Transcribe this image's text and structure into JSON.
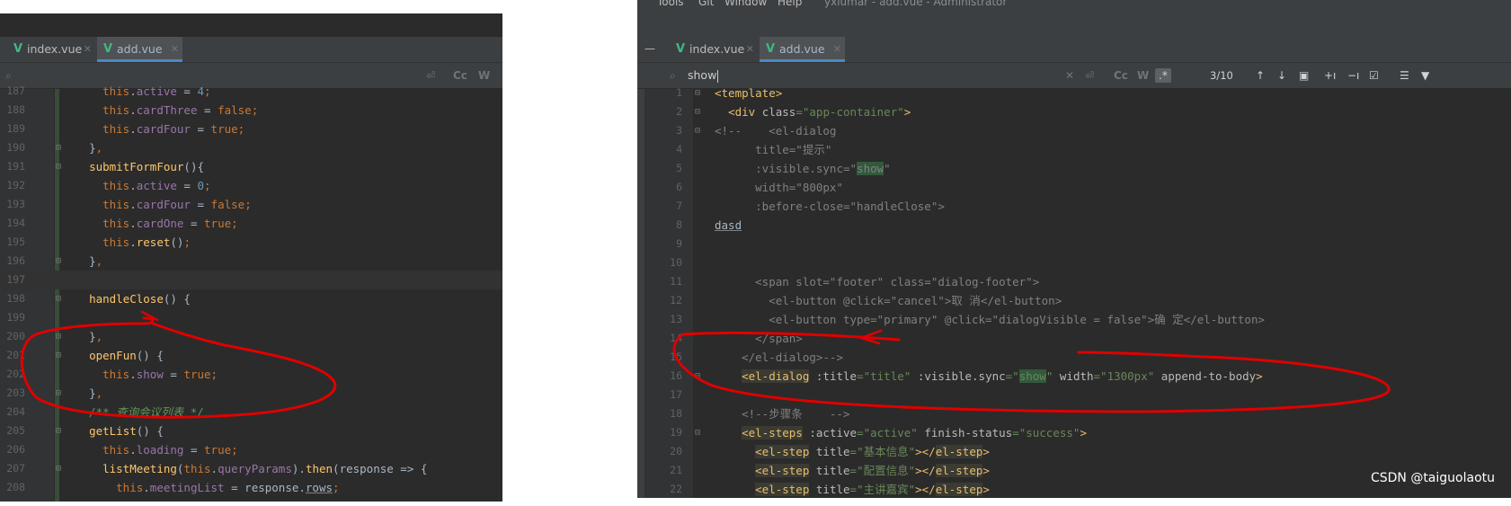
{
  "left": {
    "tabs": [
      {
        "label": "index.vue",
        "active": false
      },
      {
        "label": "add.vue",
        "active": true
      }
    ],
    "search": {
      "value": "",
      "case_label": "Cc",
      "word_label": "W"
    },
    "lines": [
      {
        "n": "187",
        "segs": [
          [
            "k",
            "    "
          ],
          [
            "k",
            "this"
          ],
          [
            "",
            "."
          ],
          [
            "p",
            "active"
          ],
          [
            "",
            " = "
          ],
          [
            "n",
            "4"
          ],
          [
            "k",
            ";"
          ]
        ]
      },
      {
        "n": "188",
        "segs": [
          [
            "",
            "    "
          ],
          [
            "k",
            "this"
          ],
          [
            "",
            "."
          ],
          [
            "p",
            "cardThree"
          ],
          [
            "",
            " = "
          ],
          [
            "k",
            "false"
          ],
          [
            "k",
            ";"
          ]
        ]
      },
      {
        "n": "189",
        "segs": [
          [
            "",
            "    "
          ],
          [
            "k",
            "this"
          ],
          [
            "",
            "."
          ],
          [
            "p",
            "cardFour"
          ],
          [
            "",
            " = "
          ],
          [
            "k",
            "true"
          ],
          [
            "k",
            ";"
          ]
        ]
      },
      {
        "n": "190",
        "segs": [
          [
            "",
            "  "
          ],
          [
            "",
            "}"
          ],
          [
            "k",
            ","
          ]
        ],
        "fold": true
      },
      {
        "n": "191",
        "segs": [
          [
            "",
            "  "
          ],
          [
            "f",
            "submitFormFour"
          ],
          [
            "",
            "(){"
          ]
        ],
        "fold": true
      },
      {
        "n": "192",
        "segs": [
          [
            "",
            "    "
          ],
          [
            "k",
            "this"
          ],
          [
            "",
            "."
          ],
          [
            "p",
            "active"
          ],
          [
            "",
            " = "
          ],
          [
            "n",
            "0"
          ],
          [
            "k",
            ";"
          ]
        ]
      },
      {
        "n": "193",
        "segs": [
          [
            "",
            "    "
          ],
          [
            "k",
            "this"
          ],
          [
            "",
            "."
          ],
          [
            "p",
            "cardFour"
          ],
          [
            "",
            " = "
          ],
          [
            "k",
            "false"
          ],
          [
            "k",
            ";"
          ]
        ]
      },
      {
        "n": "194",
        "segs": [
          [
            "",
            "    "
          ],
          [
            "k",
            "this"
          ],
          [
            "",
            "."
          ],
          [
            "p",
            "cardOne"
          ],
          [
            "",
            " = "
          ],
          [
            "k",
            "true"
          ],
          [
            "k",
            ";"
          ]
        ]
      },
      {
        "n": "195",
        "segs": [
          [
            "",
            "    "
          ],
          [
            "k",
            "this"
          ],
          [
            "",
            "."
          ],
          [
            "f",
            "reset"
          ],
          [
            "",
            "()"
          ],
          [
            "k",
            ";"
          ]
        ]
      },
      {
        "n": "196",
        "segs": [
          [
            "",
            "  "
          ],
          [
            "",
            "}"
          ],
          [
            "k",
            ","
          ]
        ],
        "fold": true
      },
      {
        "n": "197",
        "segs": [
          [
            "",
            ""
          ]
        ],
        "current": true
      },
      {
        "n": "198",
        "segs": [
          [
            "",
            "  "
          ],
          [
            "f",
            "handleClose"
          ],
          [
            "",
            "() {"
          ]
        ],
        "fold": true
      },
      {
        "n": "199",
        "segs": [
          [
            "",
            ""
          ]
        ]
      },
      {
        "n": "200",
        "segs": [
          [
            "",
            "  "
          ],
          [
            "",
            "}"
          ],
          [
            "k",
            ","
          ]
        ],
        "fold": true
      },
      {
        "n": "201",
        "segs": [
          [
            "",
            "  "
          ],
          [
            "f",
            "openFun"
          ],
          [
            "",
            "() {"
          ]
        ],
        "fold": true
      },
      {
        "n": "202",
        "segs": [
          [
            "",
            "    "
          ],
          [
            "k",
            "this"
          ],
          [
            "",
            "."
          ],
          [
            "p",
            "show"
          ],
          [
            "",
            " = "
          ],
          [
            "k",
            "true"
          ],
          [
            "k",
            ";"
          ]
        ]
      },
      {
        "n": "203",
        "segs": [
          [
            "",
            "  "
          ],
          [
            "",
            "}"
          ],
          [
            "k",
            ","
          ]
        ],
        "fold": true
      },
      {
        "n": "204",
        "segs": [
          [
            "",
            "  "
          ],
          [
            "c",
            "/** 查询会议列表 */"
          ]
        ]
      },
      {
        "n": "205",
        "segs": [
          [
            "",
            "  "
          ],
          [
            "f",
            "getList"
          ],
          [
            "",
            "() {"
          ]
        ],
        "fold": true
      },
      {
        "n": "206",
        "segs": [
          [
            "",
            "    "
          ],
          [
            "k",
            "this"
          ],
          [
            "",
            "."
          ],
          [
            "p",
            "loading"
          ],
          [
            "",
            " = "
          ],
          [
            "k",
            "true"
          ],
          [
            "k",
            ";"
          ]
        ]
      },
      {
        "n": "207",
        "segs": [
          [
            "",
            "    "
          ],
          [
            "f",
            "listMeeting"
          ],
          [
            "",
            "("
          ],
          [
            "k",
            "this"
          ],
          [
            "",
            "."
          ],
          [
            "p",
            "queryParams"
          ],
          [
            "",
            ")."
          ],
          [
            "f",
            "then"
          ],
          [
            "",
            "(response => {"
          ]
        ],
        "fold": true
      },
      {
        "n": "208",
        "segs": [
          [
            "",
            "      "
          ],
          [
            "k",
            "this"
          ],
          [
            "",
            "."
          ],
          [
            "p",
            "meetingList"
          ],
          [
            "",
            " = response."
          ],
          [
            "u",
            "rows"
          ],
          [
            "k",
            ";"
          ]
        ]
      }
    ]
  },
  "right": {
    "menu": [
      "Tools",
      "Git",
      "Window",
      "Help",
      "yxlumar - add.vue - Administrator"
    ],
    "tabs": [
      {
        "label": "index.vue",
        "active": false
      },
      {
        "label": "add.vue",
        "active": true
      }
    ],
    "search": {
      "value": "show",
      "case_label": "Cc",
      "word_label": "W",
      "regex_label": ".*",
      "match_count": "3/10"
    },
    "lines": [
      {
        "n": "1",
        "segs": [
          [
            "t",
            "<template>"
          ]
        ],
        "fold": true
      },
      {
        "n": "2",
        "segs": [
          [
            "",
            "  "
          ],
          [
            "t",
            "<div "
          ],
          [
            "a",
            "class"
          ],
          [
            "s",
            "=\"app-container\""
          ],
          [
            "t",
            ">"
          ]
        ],
        "fold": true
      },
      {
        "n": "3",
        "segs": [
          [
            "g",
            "<!--    <el-dialog"
          ]
        ],
        "fold": true
      },
      {
        "n": "4",
        "segs": [
          [
            "g",
            "      title=\"提示\""
          ]
        ]
      },
      {
        "n": "5",
        "segs": [
          [
            "g",
            "      :visible.sync=\""
          ],
          [
            "g hl",
            "show"
          ],
          [
            "g",
            "\""
          ]
        ]
      },
      {
        "n": "6",
        "segs": [
          [
            "g",
            "      width=\"800px\""
          ]
        ]
      },
      {
        "n": "7",
        "segs": [
          [
            "g",
            "      :before-close=\"handleClose\">"
          ]
        ]
      },
      {
        "n": "8",
        "segs": [
          [
            "g u",
            "dasd"
          ]
        ]
      },
      {
        "n": "9",
        "segs": [
          [
            "",
            ""
          ]
        ]
      },
      {
        "n": "10",
        "segs": [
          [
            "",
            ""
          ]
        ]
      },
      {
        "n": "11",
        "segs": [
          [
            "g",
            "      <span slot=\"footer\" class=\"dialog-footer\">"
          ]
        ]
      },
      {
        "n": "12",
        "segs": [
          [
            "g",
            "        <el-button @click=\"cancel\">取 消</el-button>"
          ]
        ]
      },
      {
        "n": "13",
        "segs": [
          [
            "g",
            "        <el-button type=\"primary\" @click=\"dialogVisible = false\">确 定</el-button>"
          ]
        ]
      },
      {
        "n": "14",
        "segs": [
          [
            "g",
            "      </span>"
          ]
        ]
      },
      {
        "n": "15",
        "segs": [
          [
            "g",
            "    </el-dialog>-->"
          ]
        ]
      },
      {
        "n": "16",
        "segs": [
          [
            "",
            "    "
          ],
          [
            "t tg",
            "<el-dialog"
          ],
          [
            "",
            " "
          ],
          [
            "a",
            ":title"
          ],
          [
            "s",
            "=\"title\""
          ],
          [
            "",
            " "
          ],
          [
            "a",
            ":visible.sync"
          ],
          [
            "s",
            "=\""
          ],
          [
            "s hl",
            "show"
          ],
          [
            "s",
            "\""
          ],
          [
            "",
            " "
          ],
          [
            "a",
            "width"
          ],
          [
            "s",
            "=\"1300px\""
          ],
          [
            "",
            " "
          ],
          [
            "a",
            "append-to-body"
          ],
          [
            "t",
            ">"
          ]
        ],
        "fold": true
      },
      {
        "n": "17",
        "segs": [
          [
            "",
            ""
          ]
        ]
      },
      {
        "n": "18",
        "segs": [
          [
            "",
            "    "
          ],
          [
            "g",
            "<!--步骤条    -->"
          ]
        ]
      },
      {
        "n": "19",
        "segs": [
          [
            "",
            "    "
          ],
          [
            "t tg",
            "<el-steps"
          ],
          [
            "",
            " "
          ],
          [
            "a",
            ":active"
          ],
          [
            "s",
            "=\"active\""
          ],
          [
            "",
            " "
          ],
          [
            "a",
            "finish-status"
          ],
          [
            "s",
            "=\"success\""
          ],
          [
            "t",
            ">"
          ]
        ],
        "fold": true
      },
      {
        "n": "20",
        "segs": [
          [
            "",
            "      "
          ],
          [
            "t tg",
            "<el-step"
          ],
          [
            "",
            " "
          ],
          [
            "a",
            "title"
          ],
          [
            "s",
            "=\"基本信息\""
          ],
          [
            "t",
            "></"
          ],
          [
            "t tg",
            "el-step"
          ],
          [
            "t",
            ">"
          ]
        ]
      },
      {
        "n": "21",
        "segs": [
          [
            "",
            "      "
          ],
          [
            "t tg",
            "<el-step"
          ],
          [
            "",
            " "
          ],
          [
            "a",
            "title"
          ],
          [
            "s",
            "=\"配置信息\""
          ],
          [
            "t",
            "></"
          ],
          [
            "t tg",
            "el-step"
          ],
          [
            "t",
            ">"
          ]
        ]
      },
      {
        "n": "22",
        "segs": [
          [
            "",
            "      "
          ],
          [
            "t tg",
            "<el-step"
          ],
          [
            "",
            " "
          ],
          [
            "a",
            "title"
          ],
          [
            "s",
            "=\"主讲嘉宾\""
          ],
          [
            "t",
            "></"
          ],
          [
            "t tg",
            "el-step"
          ],
          [
            "t",
            ">"
          ]
        ]
      }
    ]
  },
  "watermark": "CSDN @taiguolaotu",
  "colors": {
    "annotation": "#e00000",
    "accent_tab": "#4a88c7",
    "vue_icon": "#41b883"
  }
}
